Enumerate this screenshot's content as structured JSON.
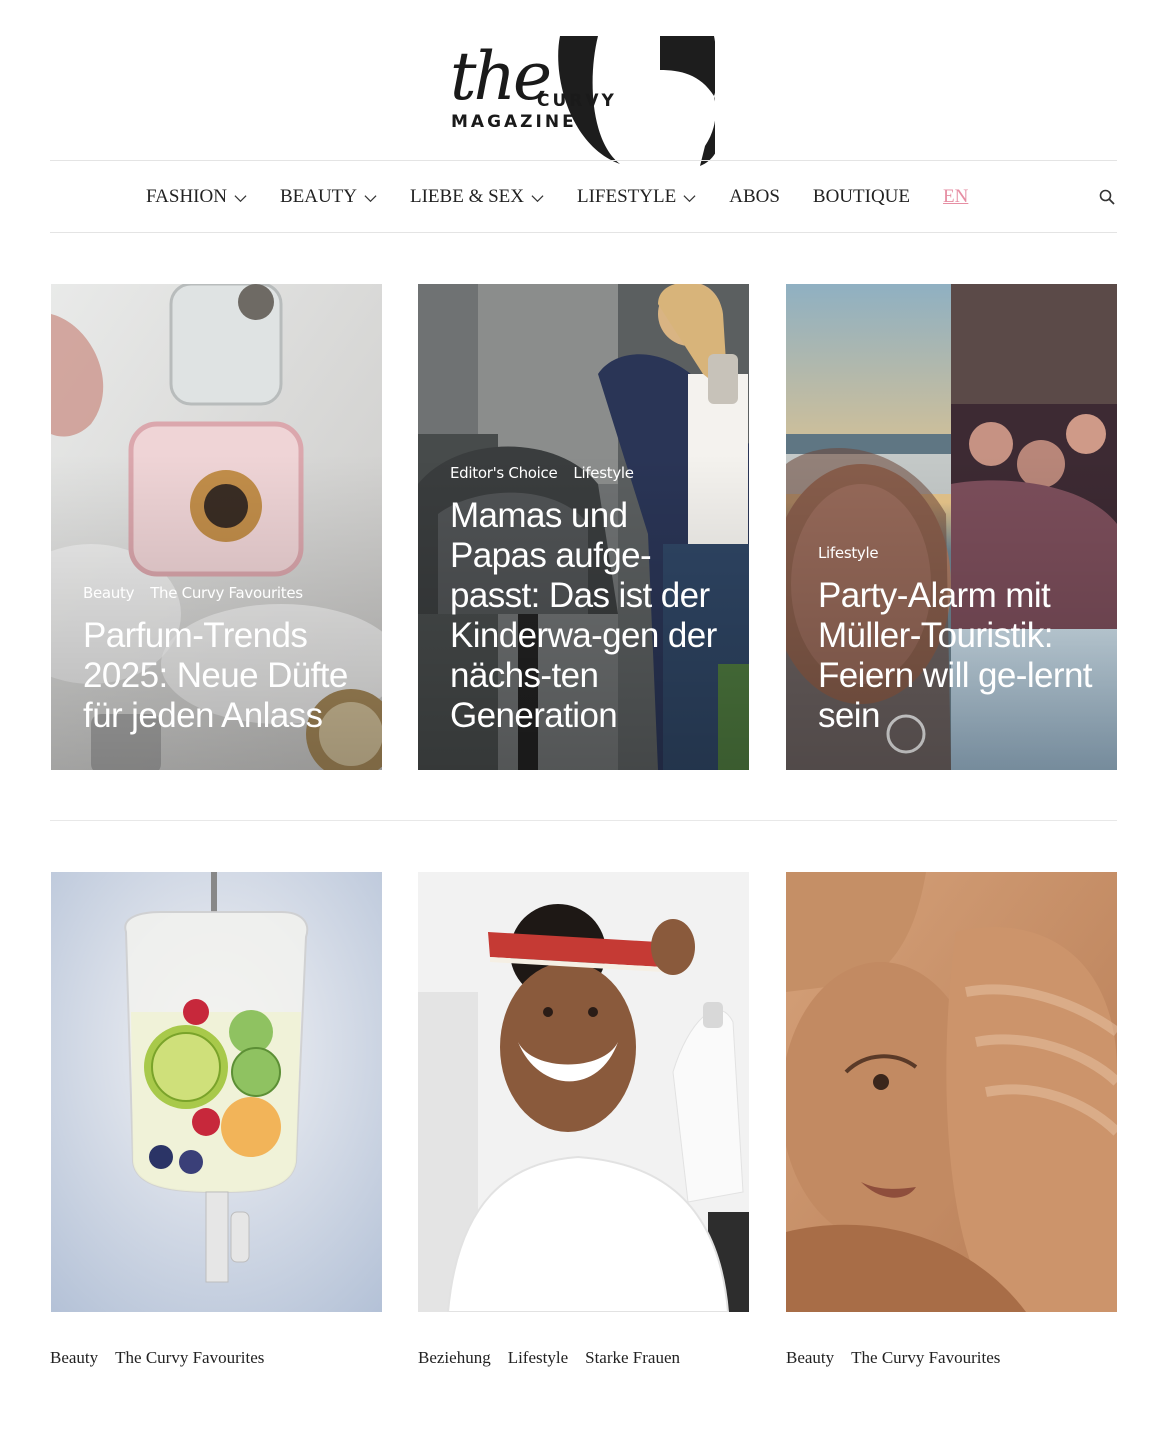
{
  "logo": {
    "the": "the",
    "curvy": "CURVY",
    "magazine": "MAGAZINE"
  },
  "nav": {
    "items": [
      {
        "label": "FASHION",
        "dropdown": true
      },
      {
        "label": "BEAUTY",
        "dropdown": true
      },
      {
        "label": "LIEBE & SEX",
        "dropdown": true
      },
      {
        "label": "LIFESTYLE",
        "dropdown": true
      },
      {
        "label": "ABOS",
        "dropdown": false
      },
      {
        "label": "BOUTIQUE",
        "dropdown": false
      },
      {
        "label": "EN",
        "dropdown": false
      }
    ],
    "accent_color": "#e68ea3",
    "search_icon": "search-icon"
  },
  "featured": [
    {
      "categories": [
        "Beauty",
        "The Curvy Favourites"
      ],
      "title": "Parfum-Trends 2025: Neue Düfte für jeden Anlass"
    },
    {
      "categories": [
        "Editor's Choice",
        "Lifestyle"
      ],
      "title": "Mamas und Papas aufge-passt: Das ist der Kinderwa-gen der nächs-ten Generation"
    },
    {
      "categories": [
        "Lifestyle"
      ],
      "title": "Party-Alarm mit Müller-Touristik: Feiern will ge-lernt sein"
    }
  ],
  "articles": [
    {
      "categories": [
        "Beauty",
        "The Curvy Favourites"
      ]
    },
    {
      "categories": [
        "Beziehung",
        "Lifestyle",
        "Starke Frauen"
      ]
    },
    {
      "categories": [
        "Beauty",
        "The Curvy Favourites"
      ]
    }
  ]
}
